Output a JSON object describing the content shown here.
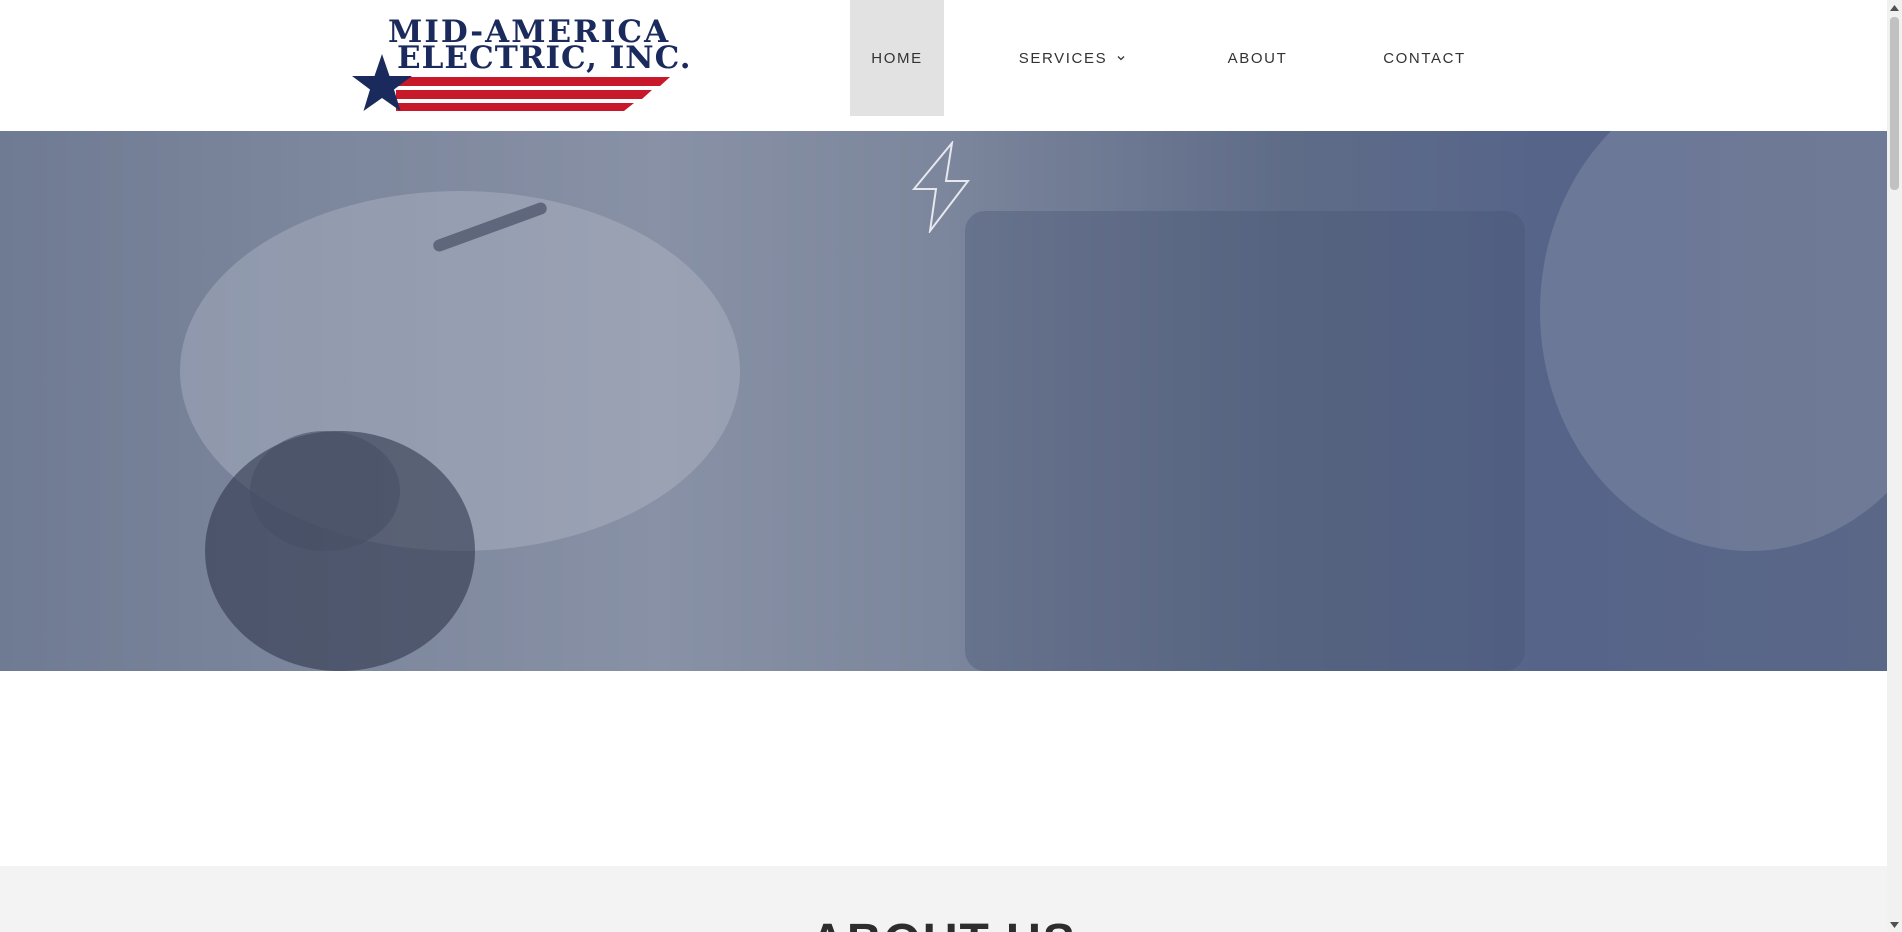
{
  "brand": {
    "line1": "MID-AMERICA",
    "line2": "ELECTRIC, INC.",
    "navy": "#1b2a5c",
    "red": "#c8192a"
  },
  "nav": {
    "items": [
      {
        "label": "HOME",
        "active": true
      },
      {
        "label": "SERVICES",
        "has_dropdown": true
      },
      {
        "label": "ABOUT"
      },
      {
        "label": "CONTACT"
      }
    ]
  },
  "hero": {
    "icon": "lightning-bolt-icon",
    "overlay_color": "#5a6787"
  },
  "about": {
    "title": "ABOUT US"
  }
}
